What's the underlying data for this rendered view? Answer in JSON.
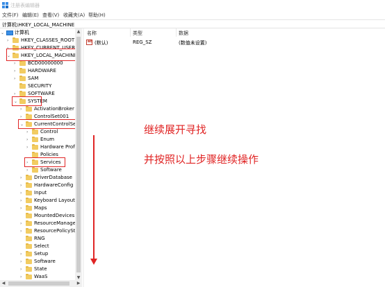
{
  "window": {
    "title": "注册表编辑器"
  },
  "menu": [
    "文件(F)",
    "编辑(E)",
    "查看(V)",
    "收藏夹(A)",
    "帮助(H)"
  ],
  "address": "计算机\\HKEY_LOCAL_MACHINE",
  "tree": [
    {
      "label": "计算机",
      "arrow": "⌄"
    },
    {
      "label": "HKEY_CLASSES_ROOT",
      "arrow": "›"
    },
    {
      "label": "HKEY_CURRENT_USER",
      "arrow": "›"
    },
    {
      "label": "HKEY_LOCAL_MACHINE",
      "arrow": "⌄"
    },
    {
      "label": "BCD00000000",
      "arrow": "›"
    },
    {
      "label": "HARDWARE",
      "arrow": "›"
    },
    {
      "label": "SAM",
      "arrow": "›"
    },
    {
      "label": "SECURITY",
      "arrow": ""
    },
    {
      "label": "SOFTWARE",
      "arrow": "›"
    },
    {
      "label": "SYSTEM",
      "arrow": "⌄"
    },
    {
      "label": "ActivationBroker",
      "arrow": "›"
    },
    {
      "label": "ControlSet001",
      "arrow": "›"
    },
    {
      "label": "CurrentControlSet",
      "arrow": "⌄"
    },
    {
      "label": "Control",
      "arrow": "›"
    },
    {
      "label": "Enum",
      "arrow": "›"
    },
    {
      "label": "Hardware Profil",
      "arrow": "›"
    },
    {
      "label": "Policies",
      "arrow": ""
    },
    {
      "label": "Services",
      "arrow": "›"
    },
    {
      "label": "Software",
      "arrow": "›"
    },
    {
      "label": "DriverDatabase",
      "arrow": "›"
    },
    {
      "label": "HardwareConfig",
      "arrow": "›"
    },
    {
      "label": "Input",
      "arrow": "›"
    },
    {
      "label": "Keyboard Layout",
      "arrow": "›"
    },
    {
      "label": "Maps",
      "arrow": "›"
    },
    {
      "label": "MountedDevices",
      "arrow": ""
    },
    {
      "label": "ResourceManager",
      "arrow": "›"
    },
    {
      "label": "ResourcePolicySto",
      "arrow": "›"
    },
    {
      "label": "RNG",
      "arrow": ""
    },
    {
      "label": "Select",
      "arrow": ""
    },
    {
      "label": "Setup",
      "arrow": "›"
    },
    {
      "label": "Software",
      "arrow": "›"
    },
    {
      "label": "State",
      "arrow": "›"
    },
    {
      "label": "WaaS",
      "arrow": "›"
    }
  ],
  "columns": {
    "name": "名称",
    "type": "类型",
    "data": "数据"
  },
  "values": [
    {
      "icon": "ab",
      "name": "(默认)",
      "type": "REG_SZ",
      "data": "(数值未设置)"
    }
  ],
  "annotations": {
    "note1": "继续展开寻找",
    "note2": "并按照以上步骤继续操作"
  },
  "colors": {
    "highlight": "#e02424",
    "folder": "#f2cc62"
  },
  "icons": {
    "up": "▲",
    "down": "▼",
    "left": "◀",
    "right": "▶"
  }
}
